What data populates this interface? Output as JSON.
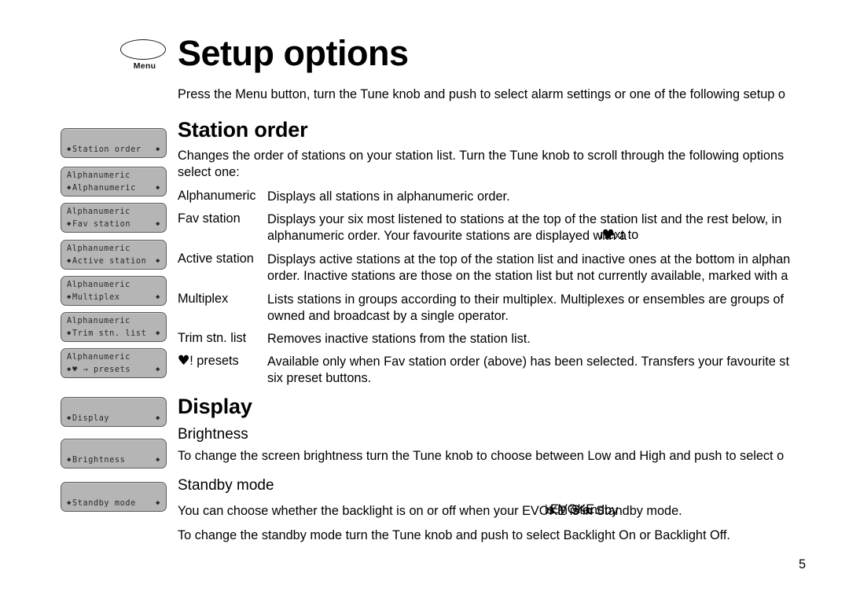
{
  "menu_button": {
    "icon": "oval-knob-icon",
    "label": "Menu"
  },
  "page_title": "Setup options",
  "intro": "Press the Menu button, turn the Tune knob and push to select alarm settings or one of the following setup o",
  "sections": [
    {
      "heading": "Station order",
      "intro_lines": [
        "Changes the order of stations on your station list. Turn the Tune knob to scroll through the following options",
        "select one:"
      ],
      "definitions": [
        {
          "label": "Alphanumeric",
          "lines": [
            "Displays all stations in alphanumeric order."
          ]
        },
        {
          "label": "Fav station",
          "lines": [
            "Displays your six most listened to stations at the top of the station list and the rest below, in",
            "alphanumeric order. Your favourite stations are displayed with a"
          ]
        },
        {
          "label": "Active station",
          "lines": [
            "Displays active stations at the top of the station list and inactive ones at the bottom in alphan",
            "order. Inactive stations are those on the station list but not currently available, marked with a"
          ]
        },
        {
          "label": "Multiplex",
          "lines": [
            "Lists stations in groups according to their multiplex. Multiplexes or ensembles are groups of",
            "owned and broadcast by a single operator."
          ]
        },
        {
          "label": "Trim stn. list",
          "lines": [
            "Removes inactive stations from the station list."
          ]
        },
        {
          "label": "! presets",
          "label_icon": "heart-icon",
          "lines": [
            "Available only when Fav station order (above) has been selected. Transfers your favourite st",
            "six preset buttons."
          ]
        }
      ]
    },
    {
      "heading": "Display",
      "subsections": [
        {
          "heading": "Brightness",
          "lines": [
            "To change the screen brightness turn the Tune knob to choose between Low and High and push to select o"
          ]
        },
        {
          "heading": "Standby mode",
          "lines": [
            "You can choose whether the backlight is on or off when your EVOKE is in Standby mode.",
            "To change the standby mode turn the Tune knob and push to select Backlight On or Backlight Off."
          ]
        }
      ]
    }
  ],
  "overlap_artifacts": [
    {
      "text": "is in Standby"
    },
    {
      "text": "EVOKE"
    }
  ],
  "lcd_screens": [
    {
      "name": "station-order",
      "top_line": "",
      "bottom_line": "Station order",
      "arrows": true,
      "heart": false
    },
    {
      "name": "alphanumeric",
      "top_line": "Alphanumeric",
      "bottom_line": "Alphanumeric",
      "arrows": true,
      "heart": false
    },
    {
      "name": "fav-station",
      "top_line": "Alphanumeric",
      "bottom_line": "Fav station",
      "arrows": true,
      "heart": false
    },
    {
      "name": "active-station",
      "top_line": "Alphanumeric",
      "bottom_line": "Active station",
      "arrows": true,
      "heart": false
    },
    {
      "name": "multiplex",
      "top_line": "Alphanumeric",
      "bottom_line": "Multiplex",
      "arrows": true,
      "heart": false
    },
    {
      "name": "trim-stn-list",
      "top_line": "Alphanumeric",
      "bottom_line": "Trim stn. list",
      "arrows": true,
      "heart": false
    },
    {
      "name": "heart-presets",
      "top_line": "Alphanumeric",
      "bottom_line": "♥ → presets",
      "arrows": true,
      "heart": true
    },
    {
      "name": "display",
      "top_line": "",
      "bottom_line": "Display",
      "arrows": true,
      "heart": false
    },
    {
      "name": "brightness",
      "top_line": "",
      "bottom_line": "Brightness",
      "arrows": true,
      "heart": false
    },
    {
      "name": "standby-mode",
      "top_line": "",
      "bottom_line": "Standby mode",
      "arrows": true,
      "heart": false
    }
  ],
  "lcd_arrow_glyph": "♦",
  "page_number": "5",
  "colors": {
    "lcd_background": "#b5b5b5",
    "lcd_border": "#5a5a5a",
    "lcd_text": "#2a2a2a",
    "page_background": "#ffffff",
    "text": "#000000"
  }
}
